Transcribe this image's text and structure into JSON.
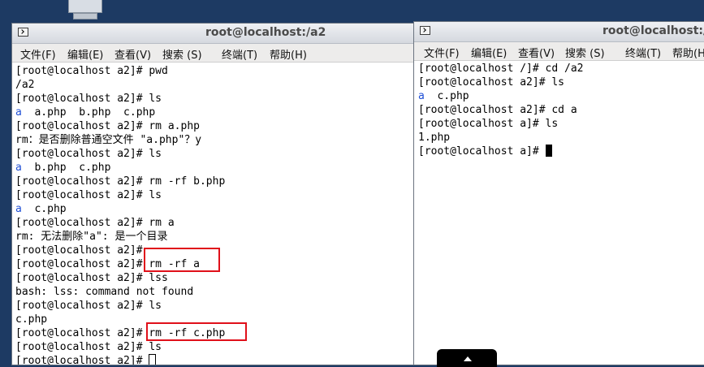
{
  "left_window": {
    "title": "root@localhost:/a2",
    "menu": [
      "文件(F)",
      "编辑(E)",
      "查看(V)",
      "搜索 (S)",
      "终端(T)",
      "帮助(H)"
    ],
    "lines": [
      {
        "p": "[root@localhost a2]# pwd"
      },
      {
        "p": "/a2"
      },
      {
        "p": "[root@localhost a2]# ls"
      },
      {
        "d": "a",
        "p": "  a.php  b.php  c.php"
      },
      {
        "p": "[root@localhost a2]# rm a.php"
      },
      {
        "p": "rm：是否删除普通空文件 \"a.php\"？y"
      },
      {
        "p": "[root@localhost a2]# ls"
      },
      {
        "d": "a",
        "p": "  b.php  c.php"
      },
      {
        "p": "[root@localhost a2]# rm -rf b.php"
      },
      {
        "p": "[root@localhost a2]# ls"
      },
      {
        "d": "a",
        "p": "  c.php"
      },
      {
        "p": "[root@localhost a2]# rm a"
      },
      {
        "p": "rm: 无法删除\"a\": 是一个目录"
      },
      {
        "p": "[root@localhost a2]#"
      },
      {
        "p": "[root@localhost a2]# rm -rf a"
      },
      {
        "p": "[root@localhost a2]# lss"
      },
      {
        "p": "bash: lss: command not found"
      },
      {
        "p": "[root@localhost a2]# ls"
      },
      {
        "p": "c.php"
      },
      {
        "p": "[root@localhost a2]# rm -rf c.php"
      },
      {
        "p": "[root@localhost a2]# ls"
      },
      {
        "p": "[root@localhost a2]# ",
        "cursor": "hollow"
      }
    ]
  },
  "right_window": {
    "title": "root@localhost:/a",
    "menu": [
      "文件(F)",
      "编辑(E)",
      "查看(V)",
      "搜索 (S)",
      "终端(T)",
      "帮助(H)"
    ],
    "lines": [
      {
        "p": "[root@localhost /]# cd /a2"
      },
      {
        "p": "[root@localhost a2]# ls"
      },
      {
        "d": "a",
        "p": "  c.php"
      },
      {
        "p": "[root@localhost a2]# cd a"
      },
      {
        "p": "[root@localhost a]# ls"
      },
      {
        "p": "1.php"
      },
      {
        "p": "[root@localhost a]# ",
        "cursor": "block"
      }
    ]
  },
  "colors": {
    "highlight": "#e0101a",
    "directory": "#1f4fd6",
    "desktop": "#1d3a63"
  }
}
